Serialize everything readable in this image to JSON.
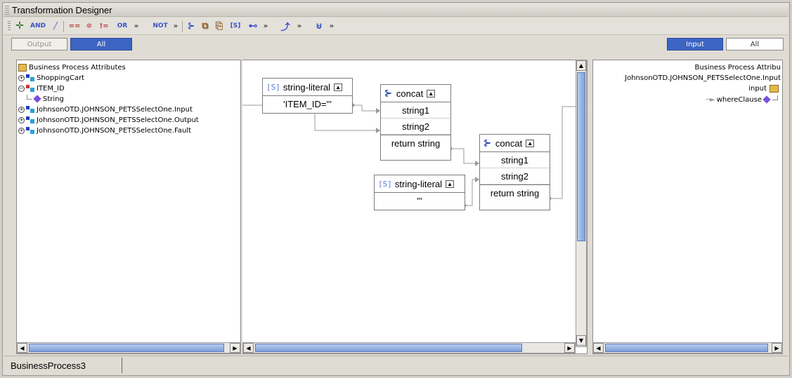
{
  "window": {
    "title": "Transformation Designer"
  },
  "toolbar": {
    "items": [
      {
        "label": "✛",
        "icon": "add-icon"
      },
      {
        "label": "AND",
        "icon": "and-operator-icon"
      },
      {
        "label": "╱",
        "icon": "divide-icon"
      },
      {
        "label": "==",
        "icon": "equals-icon"
      },
      {
        "label": "✲",
        "icon": "multiply-icon"
      },
      {
        "label": "!=",
        "icon": "not-equals-icon"
      },
      {
        "label": "OR",
        "icon": "or-operator-icon"
      },
      {
        "label": "»",
        "icon": "more-icon"
      },
      {
        "label": "NOT",
        "icon": "not-operator-icon"
      },
      {
        "label": "»",
        "icon": "more-icon"
      },
      {
        "label": "⊱",
        "icon": "concat-icon"
      },
      {
        "label": "⧉",
        "icon": "copy-icon"
      },
      {
        "label": "⎘",
        "icon": "paste-icon"
      },
      {
        "label": "[S]",
        "icon": "string-literal-icon"
      },
      {
        "label": "⊷",
        "icon": "link-icon"
      },
      {
        "label": "»",
        "icon": "more-icon"
      },
      {
        "label": "⤴",
        "icon": "branch-icon"
      },
      {
        "label": "»",
        "icon": "more-icon"
      },
      {
        "label": "⊌",
        "icon": "loop-icon"
      },
      {
        "label": "»",
        "icon": "more-icon"
      }
    ]
  },
  "left_tabs": {
    "output": "Output",
    "all": "All"
  },
  "right_tabs": {
    "input": "Input",
    "all": "All"
  },
  "left_tree": {
    "root": "Business Process Attributes",
    "items": [
      {
        "label": "ShoppingCart"
      },
      {
        "label": "ITEM_ID"
      },
      {
        "label": "String"
      },
      {
        "label": "JohnsonOTD.JOHNSON_PETSSelectOne.Input"
      },
      {
        "label": "JohnsonOTD.JOHNSON_PETSSelectOne.Output"
      },
      {
        "label": "JohnsonOTD.JOHNSON_PETSSelectOne.Fault"
      }
    ]
  },
  "canvas": {
    "literal1": {
      "title": "string-literal",
      "value": "'ITEM_ID='''"
    },
    "concat1": {
      "title": "concat",
      "string1": "string1",
      "string2": "string2",
      "return": "return string"
    },
    "literal2": {
      "title": "string-literal",
      "value": "'''"
    },
    "concat2": {
      "title": "concat",
      "string1": "string1",
      "string2": "string2",
      "return": "return string"
    },
    "icons": {
      "literal": "[S]",
      "concat": "⊱",
      "collapse": "▲"
    }
  },
  "right_tree": {
    "root": "Business Process Attribu",
    "otd": "JohnsonOTD.JOHNSON_PETSSelectOne.Input",
    "input": "input",
    "field": "whereClause"
  },
  "scroll": {
    "left": "◀",
    "right": "▶",
    "up": "▲",
    "down": "▼"
  },
  "status": {
    "tab": "BusinessProcess3"
  },
  "colors": {
    "accent": "#3c64c2",
    "diamond": "#7a4fd6",
    "toolbar_icon": "#3b52c9"
  }
}
